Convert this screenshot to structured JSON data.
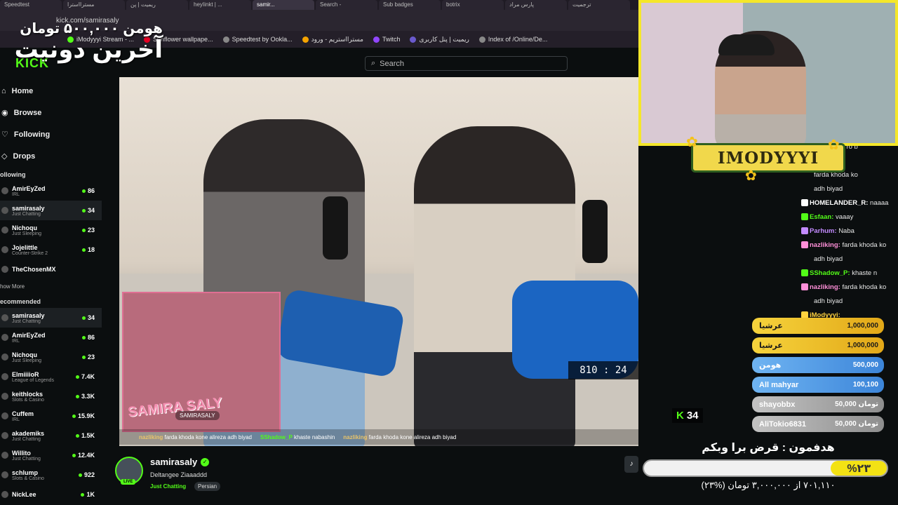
{
  "browser": {
    "tabs": [
      "Speedtest",
      "مسترااسترا",
      "ریمیت | پن",
      "heyIinkt | ...",
      "samir...",
      "Search -",
      "Sub badges",
      "botrix",
      "پارس مراد",
      "ترجمیت"
    ],
    "url": "kick.com/samirasaly",
    "bookmarks": [
      "iModyyyi Stream - ...",
      "Sunflower wallpape...",
      "Speedtest by Ookla...",
      "مسترااستریم - ورود",
      "Twitch",
      "ریمیت | پنل کاربری",
      "Index of /Online/De..."
    ]
  },
  "overlay_goal_top": {
    "line1": "هومن ۵۰۰,۰۰۰ تومان",
    "line2": "آخرین دونیت"
  },
  "header": {
    "logo": "KICK",
    "search_placeholder": "Search"
  },
  "sidebar": {
    "nav": [
      {
        "label": "Home",
        "icon": "home-icon"
      },
      {
        "label": "Browse",
        "icon": "browse-icon"
      },
      {
        "label": "Following",
        "icon": "heart-icon"
      },
      {
        "label": "Drops",
        "icon": "drops-icon"
      }
    ],
    "following_title": "ollowing",
    "following": [
      {
        "name": "AmirEyZed",
        "category": "IRL",
        "viewers": "86"
      },
      {
        "name": "samirasaly",
        "category": "Just Chatting",
        "viewers": "34"
      },
      {
        "name": "Nichoqu",
        "category": "Just Sleeping",
        "viewers": "23"
      },
      {
        "name": "Jojelittle",
        "category": "Counter-Strike 2",
        "viewers": "18"
      },
      {
        "name": "TheChosenMX",
        "category": "",
        "viewers": ""
      }
    ],
    "show_more": "how More",
    "recommended_title": "ecommended",
    "recommended": [
      {
        "name": "samirasaly",
        "category": "Just Chatting",
        "viewers": "34"
      },
      {
        "name": "AmirEyZed",
        "category": "IRL",
        "viewers": "86"
      },
      {
        "name": "Nichoqu",
        "category": "Just Sleeping",
        "viewers": "23"
      },
      {
        "name": "ElmiiiioR",
        "category": "League of Legends",
        "viewers": "7.4K"
      },
      {
        "name": "keithlocks",
        "category": "Slots & Casino",
        "viewers": "3.3K"
      },
      {
        "name": "Cuffem",
        "category": "IRL",
        "viewers": "15.9K"
      },
      {
        "name": "akademiks",
        "category": "Just Chatting",
        "viewers": "1.5K"
      },
      {
        "name": "Willito",
        "category": "Just Chatting",
        "viewers": "12.4K"
      },
      {
        "name": "schlump",
        "category": "Slots & Casino",
        "viewers": "922"
      },
      {
        "name": "NickLee",
        "category": "",
        "viewers": "1K"
      }
    ]
  },
  "video": {
    "pip_label": "SAMIRA SALY",
    "pip_handle": "SAMIRASALY",
    "timer": "810 : 24",
    "ticker": [
      {
        "user": "nazliking",
        "text": "farda khoda kone alireza adh biyad"
      },
      {
        "user": "SShadow_P",
        "text": "khaste nabashin"
      },
      {
        "user": "nazliking",
        "text": "farda khoda kone alireza adh biyad"
      }
    ],
    "viewer_count": "34"
  },
  "stream_info": {
    "name": "samirasaly",
    "live": "LIVE",
    "title": "Deltangee Ziaaaddd",
    "category": "Just Chatting",
    "tag": "Persian"
  },
  "webcam": {
    "banner": "IMODYYYI"
  },
  "chat": [
    {
      "user": "",
      "text": "samira hal ro b",
      "color": "#ccc"
    },
    {
      "user": "Esfaan:",
      "text": "",
      "color": "#53fc18"
    },
    {
      "user": "",
      "text": "farda khoda ko",
      "color": "#ccc"
    },
    {
      "user": "",
      "text": "adh biyad",
      "color": "#ccc"
    },
    {
      "user": "HOMELANDER_R:",
      "text": "naaaa",
      "color": "#ffffff"
    },
    {
      "user": "Esfaan:",
      "text": "vaaay",
      "color": "#53fc18"
    },
    {
      "user": "Parhum:",
      "text": "Naba",
      "color": "#c38bff"
    },
    {
      "user": "nazliking:",
      "text": "farda khoda ko",
      "color": "#ff8fd8"
    },
    {
      "user": "",
      "text": "adh biyad",
      "color": "#ccc"
    },
    {
      "user": "SShadow_P:",
      "text": "khaste n",
      "color": "#53fc18"
    },
    {
      "user": "nazliking:",
      "text": "farda khoda ko",
      "color": "#ff8fd8"
    },
    {
      "user": "",
      "text": "adh biyad",
      "color": "#ccc"
    },
    {
      "user": "iModyyyi:",
      "text": "",
      "color": "#ffd23f"
    }
  ],
  "leaderboard": [
    {
      "name": "عرشیا",
      "amount": "1,000,000",
      "style": "gold"
    },
    {
      "name": "عرشیا",
      "amount": "1,000,000",
      "style": "gold"
    },
    {
      "name": "هومن",
      "amount": "500,000",
      "style": "blue"
    },
    {
      "name": "All mahyar",
      "amount": "100,100",
      "style": "blue"
    },
    {
      "name": "shayobbx",
      "amount": "50,000 تومان",
      "style": "grey"
    },
    {
      "name": "AliTokio6831",
      "amount": "50,000 تومان",
      "style": "grey"
    }
  ],
  "goal": {
    "title": "هدفمون : قرض برا وبکم",
    "percent_label": "%۲۳",
    "fraction": 0.23,
    "progress_text": "۷۰۱,۱۱۰ از ۳,۰۰۰,۰۰۰ تومان (%۲۳)"
  }
}
